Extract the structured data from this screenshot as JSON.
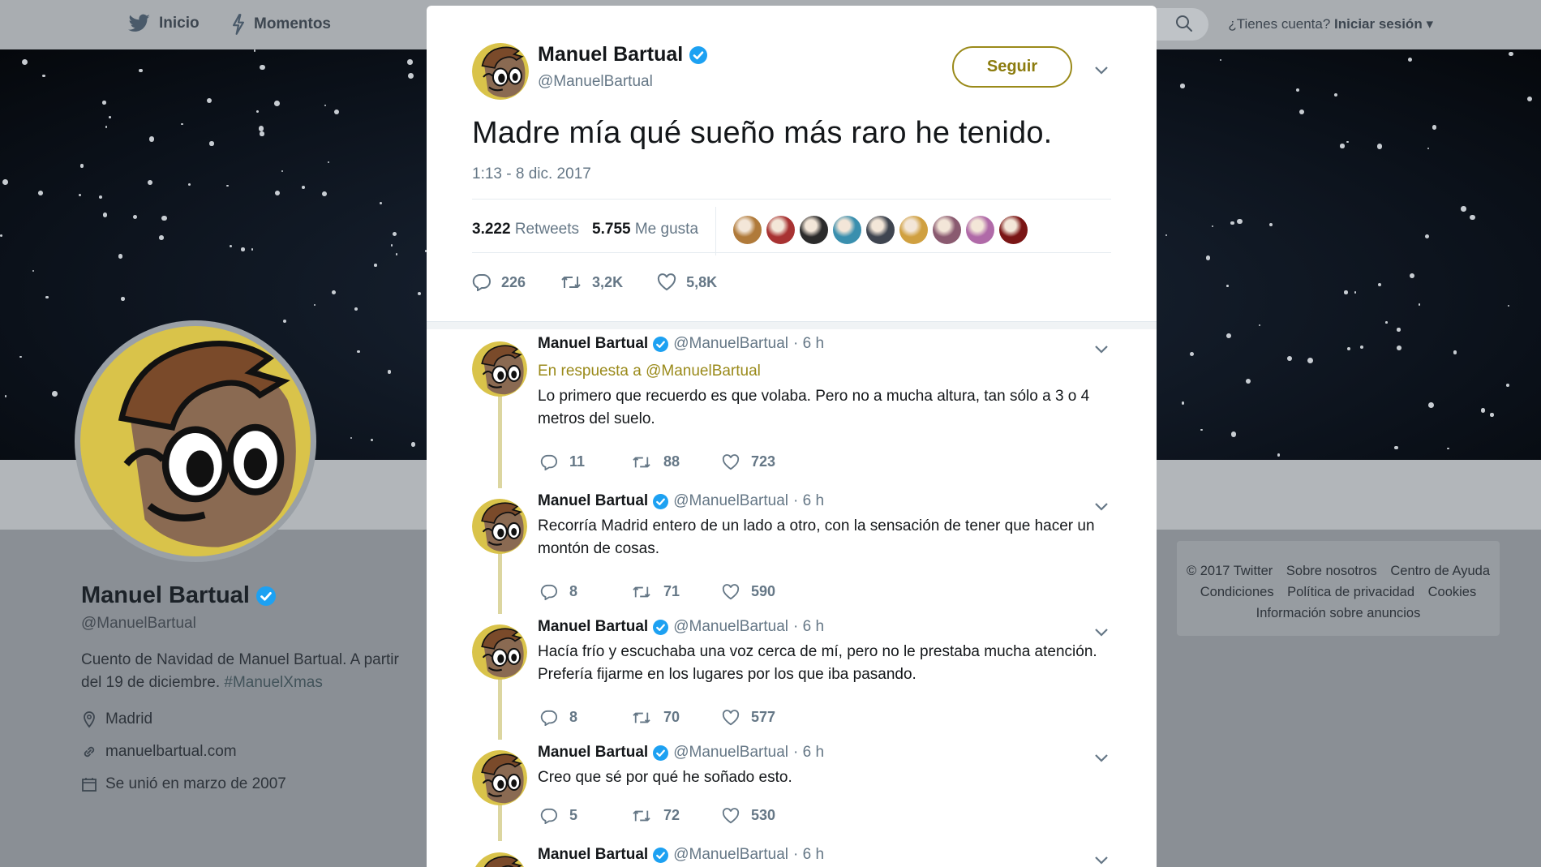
{
  "nav": {
    "home": "Inicio",
    "moments": "Momentos",
    "have_account": "¿Tienes cuenta?",
    "login": "Iniciar sesión"
  },
  "profile": {
    "name": "Manuel Bartual",
    "handle": "@ManuelBartual",
    "bio": "Cuento de Navidad de Manuel Bartual. A partir del 19 de diciembre.",
    "bio_hashtag": "#ManuelXmas",
    "location": "Madrid",
    "website": "manuelbartual.com",
    "joined": "Se unió en marzo de 2007"
  },
  "footer": {
    "copyright": "© 2017 Twitter",
    "about": "Sobre nosotros",
    "help": "Centro de Ayuda",
    "terms": "Condiciones",
    "privacy": "Política de privacidad",
    "cookies": "Cookies",
    "ads": "Información sobre anuncios"
  },
  "modal": {
    "author_name": "Manuel Bartual",
    "author_handle": "@ManuelBartual",
    "follow_label": "Seguir",
    "text": "Madre mía qué sueño más raro he tenido.",
    "timestamp": "1:13 - 8 dic. 2017",
    "retweets_count": "3.222",
    "retweets_label": "Retweets",
    "likes_count": "5.755",
    "likes_label": "Me gusta",
    "reply_count": "226",
    "retweet_short": "3,2K",
    "like_short": "5,8K"
  },
  "replies": [
    {
      "name": "Manuel Bartual",
      "handle": "@ManuelBartual",
      "time": "· 6 h",
      "in_reply_prefix": "En respuesta a",
      "in_reply_handle": "@ManuelBartual",
      "text": "Lo primero que recuerdo es que volaba. Pero no a mucha altura, tan sólo a 3 o 4 metros del suelo.",
      "replies": "11",
      "retweets": "88",
      "likes": "723"
    },
    {
      "name": "Manuel Bartual",
      "handle": "@ManuelBartual",
      "time": "· 6 h",
      "text": "Recorría Madrid entero de un lado a otro, con la sensación de tener que hacer un montón de cosas.",
      "replies": "8",
      "retweets": "71",
      "likes": "590"
    },
    {
      "name": "Manuel Bartual",
      "handle": "@ManuelBartual",
      "time": "· 6 h",
      "text": "Hacía frío y escuchaba una voz cerca de mí, pero no le prestaba mucha atención. Prefería fijarme en los lugares por los que iba pasando.",
      "replies": "8",
      "retweets": "70",
      "likes": "577"
    },
    {
      "name": "Manuel Bartual",
      "handle": "@ManuelBartual",
      "time": "· 6 h",
      "text": "Creo que sé por qué he soñado esto.",
      "replies": "5",
      "retweets": "72",
      "likes": "530"
    },
    {
      "name": "Manuel Bartual",
      "handle": "@ManuelBartual",
      "time": "· 6 h"
    }
  ],
  "colors": {
    "accent": "#9a8a1a",
    "verified": "#1da1f2",
    "thread_line": "#dcd6a0",
    "overlay": "#8a8f95"
  },
  "likers": [
    "#b07a3a",
    "#a83232",
    "#2b2b2b",
    "#3a8fae",
    "#3f4550",
    "#d0a040",
    "#8a5a70",
    "#b06aa8",
    "#7a1515"
  ]
}
